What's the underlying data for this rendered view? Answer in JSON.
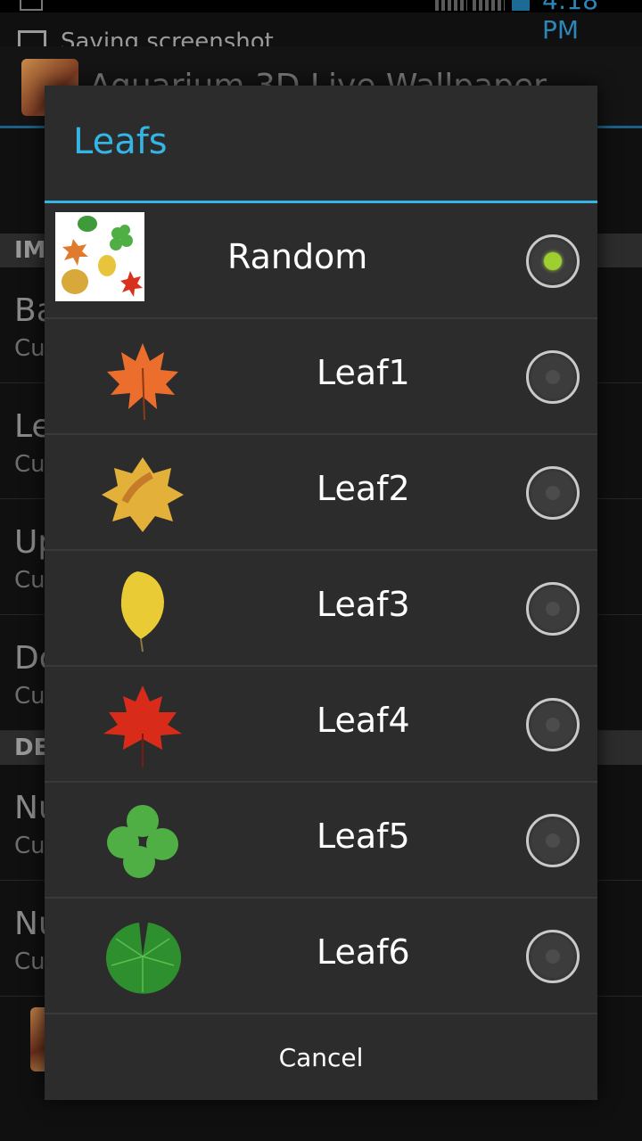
{
  "status_bar": {
    "time": "4:18 PM"
  },
  "notification": {
    "text": "Saving screenshot"
  },
  "background": {
    "app_title": "Aquarium 3D Live Wallpaper",
    "sections": [
      "IMAGES",
      "DETAILS"
    ],
    "rows": [
      {
        "title": "Ba",
        "subtitle": "Cu"
      },
      {
        "title": "Le",
        "subtitle": "Cu"
      },
      {
        "title": "Up",
        "subtitle": "Cu"
      },
      {
        "title": "Do",
        "subtitle": "Cu"
      },
      {
        "title": "Nu",
        "subtitle": "Cu"
      },
      {
        "title": "Nu",
        "subtitle": "Cu"
      }
    ]
  },
  "dialog": {
    "title": "Leafs",
    "selected": "Random",
    "options": [
      {
        "label": "Random",
        "icon": "random-leaves-icon",
        "checked": true
      },
      {
        "label": "Leaf1",
        "icon": "maple-leaf-orange-icon",
        "checked": false
      },
      {
        "label": "Leaf2",
        "icon": "autumn-leaf-yellow-icon",
        "checked": false
      },
      {
        "label": "Leaf3",
        "icon": "yellow-leaf-icon",
        "checked": false
      },
      {
        "label": "Leaf4",
        "icon": "red-maple-leaf-icon",
        "checked": false
      },
      {
        "label": "Leaf5",
        "icon": "clover-leaf-icon",
        "checked": false
      },
      {
        "label": "Leaf6",
        "icon": "lily-pad-icon",
        "checked": false
      }
    ],
    "cancel_label": "Cancel"
  },
  "colors": {
    "accent": "#33b5e5",
    "radio_checked": "#9ccf2f",
    "dialog_bg": "#2c2c2c"
  }
}
